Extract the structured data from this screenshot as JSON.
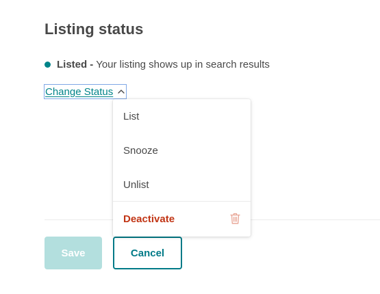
{
  "page": {
    "title": "Listing status"
  },
  "status": {
    "name": "Listed",
    "separator": "-",
    "description": "Your listing shows up in search results",
    "dot_color": "#008489"
  },
  "change_status": {
    "label": "Change Status",
    "icon": "chevron-up-icon",
    "expanded": true
  },
  "dropdown": {
    "items": [
      {
        "label": "List"
      },
      {
        "label": "Snooze"
      },
      {
        "label": "Unlist"
      },
      {
        "label": "Deactivate",
        "icon": "trash-icon",
        "color": "#c13515"
      }
    ]
  },
  "actions": {
    "save_label": "Save",
    "save_disabled": true,
    "cancel_label": "Cancel"
  },
  "colors": {
    "accent": "#008489",
    "danger": "#c13515",
    "disabled_button": "#b3dfde"
  }
}
